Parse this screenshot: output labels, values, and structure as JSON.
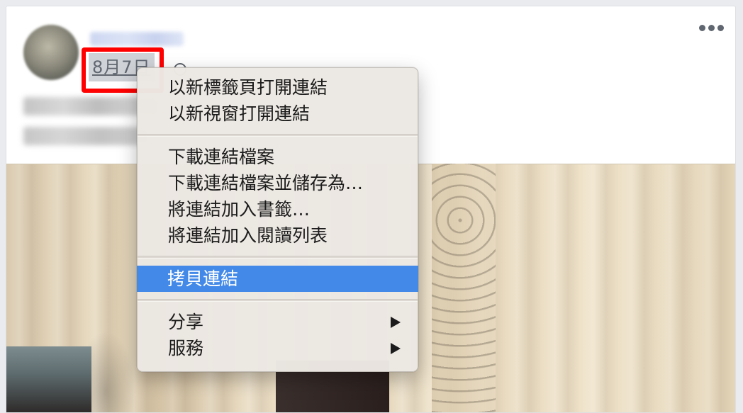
{
  "post": {
    "date": "8月7日"
  },
  "context_menu": {
    "groups": [
      [
        {
          "label": "以新標籤頁打開連結"
        },
        {
          "label": "以新視窗打開連結"
        }
      ],
      [
        {
          "label": "下載連結檔案"
        },
        {
          "label": "下載連結檔案並儲存為…"
        },
        {
          "label": "將連結加入書籤…"
        },
        {
          "label": "將連結加入閱讀列表"
        }
      ],
      [
        {
          "label": "拷貝連結",
          "highlighted": true
        }
      ],
      [
        {
          "label": "分享",
          "submenu": true
        },
        {
          "label": "服務",
          "submenu": true
        }
      ]
    ]
  },
  "colors": {
    "highlight": "#4289e8",
    "annotation_box": "#ff0000"
  },
  "icons": {
    "more": "more-horizontal-icon",
    "privacy": "globe-icon",
    "submenu": "chevron-right-icon"
  }
}
